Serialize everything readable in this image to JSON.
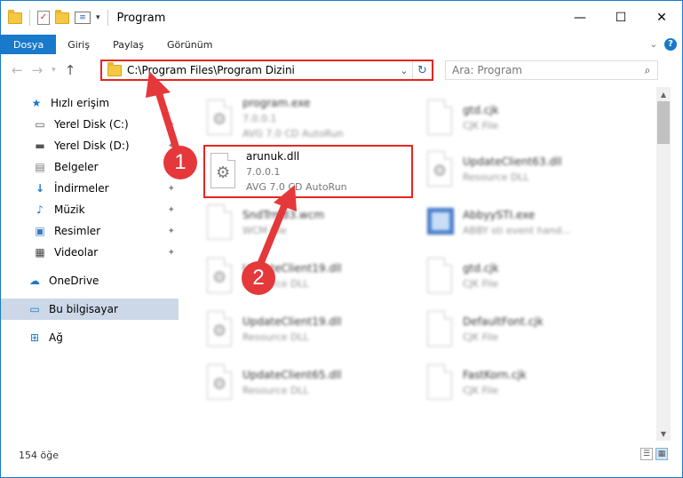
{
  "window": {
    "title": "Program",
    "minimize": "—",
    "maximize": "☐",
    "close": "✕"
  },
  "ribbon": {
    "tabs": [
      "Dosya",
      "Giriş",
      "Paylaş",
      "Görünüm"
    ],
    "help": "?"
  },
  "address": {
    "path": "C:\\Program Files\\Program Dizini",
    "search_placeholder": "Ara: Program"
  },
  "nav_pane": {
    "items": [
      {
        "label": "Hızlı erişim",
        "icon": "star-icon"
      },
      {
        "label": "Yerel Disk (C:)",
        "icon": "drive-icon",
        "pinned": true
      },
      {
        "label": "Yerel Disk (D:)",
        "icon": "drive-icon",
        "pinned": true
      },
      {
        "label": "Belgeler",
        "icon": "documents-icon",
        "pinned": true
      },
      {
        "label": "İndirmeler",
        "icon": "download-icon",
        "pinned": true
      },
      {
        "label": "Müzik",
        "icon": "music-icon",
        "pinned": true
      },
      {
        "label": "Resimler",
        "icon": "pictures-icon",
        "pinned": true
      },
      {
        "label": "Videolar",
        "icon": "videos-icon",
        "pinned": true
      },
      {
        "label": "OneDrive",
        "icon": "cloud-icon"
      },
      {
        "label": "Bu bilgisayar",
        "icon": "computer-icon"
      },
      {
        "label": "Ağ",
        "icon": "network-icon"
      }
    ]
  },
  "files": [
    {
      "name": "program.exe",
      "line2": "7.0.0.1",
      "line3": "AVG 7.0 CD AutoRun",
      "icon": "exe-icon"
    },
    {
      "name": "gtd.cjk",
      "line2": "CJK File",
      "line3": "",
      "icon": "file-icon"
    },
    {
      "name": "arunuk.dll",
      "line2": "7.0.0.1",
      "line3": "AVG 7.0 CD AutoRun",
      "icon": "dll-gear-icon"
    },
    {
      "name": "UpdateClient63.dll",
      "line2": "Resource DLL",
      "line3": "",
      "icon": "dll-gear-icon"
    },
    {
      "name": "SndTrm83.wcm",
      "line2": "WCM File",
      "line3": "",
      "icon": "file-icon"
    },
    {
      "name": "AbbyySTI.exe",
      "line2": "ABBY sti event hand...",
      "line3": "",
      "icon": "app-icon"
    },
    {
      "name": "UpdateClient19.dll",
      "line2": "Resource DLL",
      "line3": "",
      "icon": "dll-gear-icon"
    },
    {
      "name": "gtd.cjk",
      "line2": "CJK File",
      "line3": "",
      "icon": "file-icon"
    },
    {
      "name": "UpdateClient19.dll",
      "line2": "Resource DLL",
      "line3": "",
      "icon": "dll-gear-icon"
    },
    {
      "name": "DefaultFont.cjk",
      "line2": "CJK File",
      "line3": "",
      "icon": "file-icon"
    },
    {
      "name": "UpdateClient65.dll",
      "line2": "Resource DLL",
      "line3": "",
      "icon": "dll-gear-icon"
    },
    {
      "name": "FastKorn.cjk",
      "line2": "CJK File",
      "line3": "",
      "icon": "file-icon"
    }
  ],
  "status": {
    "item_count": "154 öğe"
  },
  "annotations": {
    "step1": "1",
    "step2": "2"
  },
  "colors": {
    "accent": "#1979ca",
    "highlight": "#e52620",
    "arrow": "#e5383b",
    "selected_nav": "#ccd8e8"
  }
}
